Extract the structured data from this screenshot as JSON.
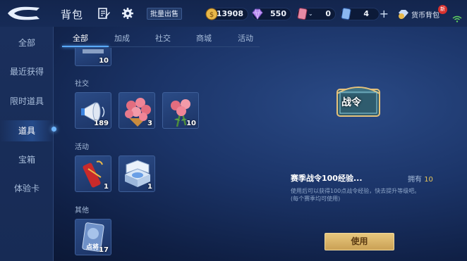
{
  "header": {
    "title": "背包",
    "bulk_sell_label": "批量出售",
    "currencies": [
      {
        "icon": "gold-coin-icon",
        "value": "13908"
      },
      {
        "icon": "diamond-icon",
        "value": "550"
      },
      {
        "icon": "ticket-icon",
        "value": "0"
      },
      {
        "icon": "voucher-icon",
        "value": "4"
      }
    ],
    "wallet_label": "货币背包",
    "wallet_badge": "新"
  },
  "sidebar": {
    "items": [
      {
        "label": "全部"
      },
      {
        "label": "最近获得"
      },
      {
        "label": "限时道具"
      },
      {
        "label": "道具"
      },
      {
        "label": "宝箱"
      },
      {
        "label": "体验卡"
      }
    ],
    "active_index": 3
  },
  "tabs": {
    "items": [
      {
        "label": "全部"
      },
      {
        "label": "加成"
      },
      {
        "label": "社交"
      },
      {
        "label": "商城"
      },
      {
        "label": "活动"
      }
    ],
    "active_index": 0
  },
  "inventory": {
    "top_partial_item": {
      "count": "10"
    },
    "sections": [
      {
        "label": "社交",
        "items": [
          {
            "name": "megaphone-item",
            "count": "189"
          },
          {
            "name": "rose-bouquet-item",
            "count": "3"
          },
          {
            "name": "rose-item",
            "count": "10"
          }
        ]
      },
      {
        "label": "活动",
        "items": [
          {
            "name": "firecracker-item",
            "count": "1"
          },
          {
            "name": "disc-box-item",
            "count": "1"
          }
        ]
      },
      {
        "label": "其他",
        "items": [
          {
            "name": "point-card-item",
            "count": "17",
            "card_text": "点将"
          }
        ]
      }
    ]
  },
  "detail": {
    "chest_text": "战令",
    "title": "赛季战令100经验...",
    "owned_label": "拥有",
    "owned_value": "10",
    "description": "使用后可以获得100点战令经验，快去提升等级吧。",
    "description_note": "(每个赛季均可使用)",
    "use_label": "使用"
  },
  "colors": {
    "accent": "#5aaaff",
    "gold": "#e7c55a",
    "button_gold": "#d9b467"
  }
}
